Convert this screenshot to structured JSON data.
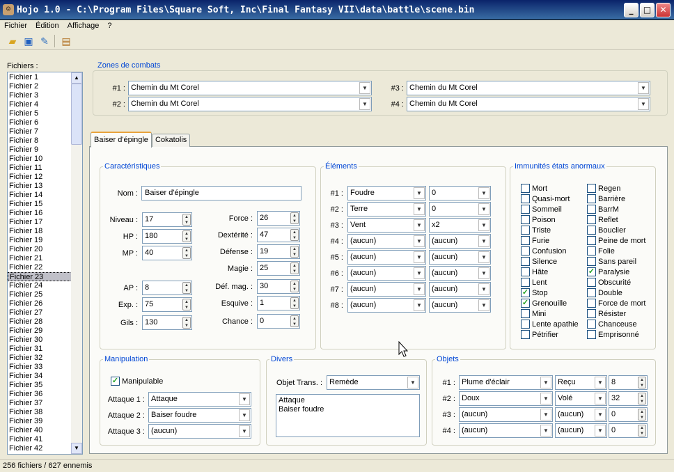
{
  "window": {
    "title": "Hojo 1.0 - C:\\Program Files\\Square Soft, Inc\\Final Fantasy VII\\data\\battle\\scene.bin"
  },
  "menu": [
    "Fichier",
    "Édition",
    "Affichage",
    "?"
  ],
  "toolbar": {
    "icons": [
      "open-folder-icon",
      "save-icon",
      "edit-icon",
      "paste-icon"
    ]
  },
  "files": {
    "label": "Fichiers :",
    "items": [
      "Fichier 1",
      "Fichier 2",
      "Fichier 3",
      "Fichier 4",
      "Fichier 5",
      "Fichier 6",
      "Fichier 7",
      "Fichier 8",
      "Fichier 9",
      "Fichier 10",
      "Fichier 11",
      "Fichier 12",
      "Fichier 13",
      "Fichier 14",
      "Fichier 15",
      "Fichier 16",
      "Fichier 17",
      "Fichier 18",
      "Fichier 19",
      "Fichier 20",
      "Fichier 21",
      "Fichier 22",
      "Fichier 23",
      "Fichier 24",
      "Fichier 25",
      "Fichier 26",
      "Fichier 27",
      "Fichier 28",
      "Fichier 29",
      "Fichier 30",
      "Fichier 31",
      "Fichier 32",
      "Fichier 33",
      "Fichier 34",
      "Fichier 35",
      "Fichier 36",
      "Fichier 37",
      "Fichier 38",
      "Fichier 39",
      "Fichier 40",
      "Fichier 41",
      "Fichier 42"
    ],
    "selected": "Fichier 23"
  },
  "zones": {
    "title": "Zones de combats",
    "z1_label": "#1 :",
    "z1": "Chemin du Mt Corel",
    "z2_label": "#2 :",
    "z2": "Chemin du Mt Corel",
    "z3_label": "#3 :",
    "z3": "Chemin du Mt Corel",
    "z4_label": "#4 :",
    "z4": "Chemin du Mt Corel"
  },
  "tabs": [
    "Baiser d'épingle",
    "Cokatolis"
  ],
  "carac": {
    "title": "Caractéristiques",
    "nom_label": "Nom :",
    "nom": "Baiser d'épingle",
    "left": [
      {
        "label": "Niveau :",
        "value": "17"
      },
      {
        "label": "HP :",
        "value": "180"
      },
      {
        "label": "MP :",
        "value": "40"
      },
      {
        "label": "AP :",
        "value": "8"
      },
      {
        "label": "Exp. :",
        "value": "75"
      },
      {
        "label": "Gils :",
        "value": "130"
      }
    ],
    "right": [
      {
        "label": "Force :",
        "value": "26"
      },
      {
        "label": "Dextérité :",
        "value": "47"
      },
      {
        "label": "Défense :",
        "value": "19"
      },
      {
        "label": "Magie :",
        "value": "25"
      },
      {
        "label": "Déf. mag. :",
        "value": "30"
      },
      {
        "label": "Esquive :",
        "value": "1"
      },
      {
        "label": "Chance :",
        "value": "0"
      }
    ]
  },
  "elements": {
    "title": "Éléments",
    "rows": [
      {
        "label": "#1 :",
        "element": "Foudre",
        "mod": "0"
      },
      {
        "label": "#2 :",
        "element": "Terre",
        "mod": "0"
      },
      {
        "label": "#3 :",
        "element": "Vent",
        "mod": "x2"
      },
      {
        "label": "#4 :",
        "element": "(aucun)",
        "mod": "(aucun)"
      },
      {
        "label": "#5 :",
        "element": "(aucun)",
        "mod": "(aucun)"
      },
      {
        "label": "#6 :",
        "element": "(aucun)",
        "mod": "(aucun)"
      },
      {
        "label": "#7 :",
        "element": "(aucun)",
        "mod": "(aucun)"
      },
      {
        "label": "#8 :",
        "element": "(aucun)",
        "mod": "(aucun)"
      }
    ]
  },
  "immunites": {
    "title": "Immunités états anormaux",
    "col1": [
      {
        "label": "Mort",
        "checked": false
      },
      {
        "label": "Quasi-mort",
        "checked": false
      },
      {
        "label": "Sommeil",
        "checked": false
      },
      {
        "label": "Poison",
        "checked": false
      },
      {
        "label": "Triste",
        "checked": false
      },
      {
        "label": "Furie",
        "checked": false
      },
      {
        "label": "Confusion",
        "checked": false
      },
      {
        "label": "Silence",
        "checked": false
      },
      {
        "label": "Hâte",
        "checked": false
      },
      {
        "label": "Lent",
        "checked": false
      },
      {
        "label": "Stop",
        "checked": true
      },
      {
        "label": "Grenouille",
        "checked": true
      },
      {
        "label": "Mini",
        "checked": false
      },
      {
        "label": "Lente apathie",
        "checked": false
      },
      {
        "label": "Pétrifier",
        "checked": false
      }
    ],
    "col2": [
      {
        "label": "Regen",
        "checked": false
      },
      {
        "label": "Barrière",
        "checked": false
      },
      {
        "label": "BarrM",
        "checked": false
      },
      {
        "label": "Reflet",
        "checked": false
      },
      {
        "label": "Bouclier",
        "checked": false
      },
      {
        "label": "Peine de mort",
        "checked": false
      },
      {
        "label": "Folie",
        "checked": false
      },
      {
        "label": "Sans pareil",
        "checked": false
      },
      {
        "label": "Paralysie",
        "checked": true
      },
      {
        "label": "Obscurité",
        "checked": false
      },
      {
        "label": "Double",
        "checked": false
      },
      {
        "label": "Force de mort",
        "checked": false
      },
      {
        "label": "Résister",
        "checked": false
      },
      {
        "label": "Chanceuse",
        "checked": false
      },
      {
        "label": "Emprisonné",
        "checked": false
      }
    ]
  },
  "manipulation": {
    "title": "Manipulation",
    "checkbox_label": "Manipulable",
    "checked": true,
    "attacks": [
      {
        "label": "Attaque 1 :",
        "value": "Attaque"
      },
      {
        "label": "Attaque 2 :",
        "value": "Baiser foudre"
      },
      {
        "label": "Attaque 3 :",
        "value": "(aucun)"
      }
    ]
  },
  "divers": {
    "title": "Divers",
    "objet_label": "Objet Trans. :",
    "objet": "Remède",
    "list": [
      "Attaque",
      "Baiser foudre"
    ]
  },
  "objets": {
    "title": "Objets",
    "rows": [
      {
        "label": "#1 :",
        "item": "Plume d'éclair",
        "mode": "Reçu",
        "qty": "8"
      },
      {
        "label": "#2 :",
        "item": "Doux",
        "mode": "Volé",
        "qty": "32"
      },
      {
        "label": "#3 :",
        "item": "(aucun)",
        "mode": "(aucun)",
        "qty": "0"
      },
      {
        "label": "#4 :",
        "item": "(aucun)",
        "mode": "(aucun)",
        "qty": "0"
      }
    ]
  },
  "status": {
    "text": "256 fichiers / 627 ennemis"
  }
}
